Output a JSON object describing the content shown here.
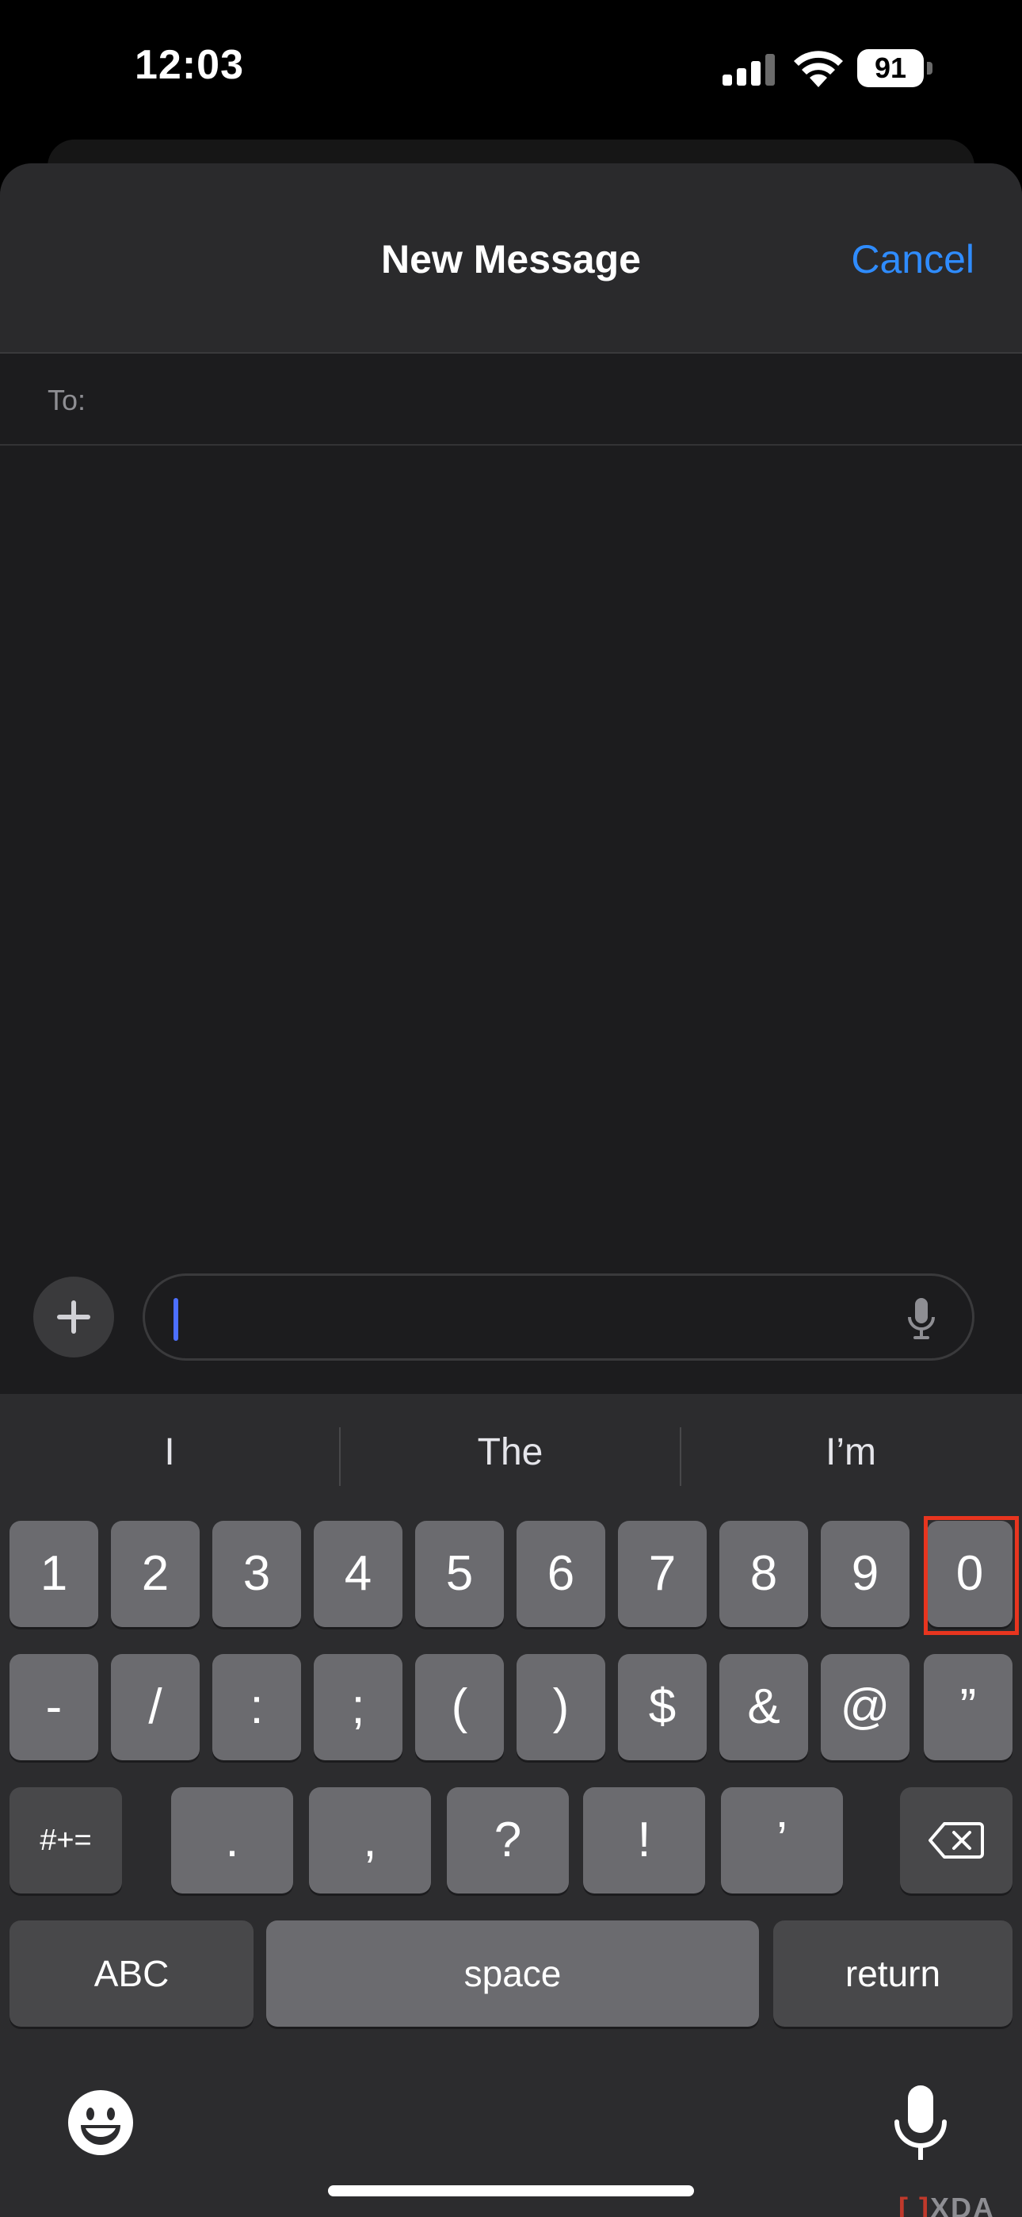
{
  "status_bar": {
    "time": "12:03",
    "battery": "91"
  },
  "header": {
    "title": "New Message",
    "cancel_label": "Cancel"
  },
  "to_field": {
    "label": "To:"
  },
  "message_input": {
    "value": ""
  },
  "predictions": [
    "I",
    "The",
    "I’m"
  ],
  "keyboard": {
    "row1": [
      "1",
      "2",
      "3",
      "4",
      "5",
      "6",
      "7",
      "8",
      "9",
      "0"
    ],
    "row2": [
      "-",
      "/",
      ":",
      ";",
      "(",
      ")",
      "$",
      "&",
      "@",
      "”"
    ],
    "row3": [
      "#+=",
      ".",
      ",",
      "?",
      "!",
      "’"
    ],
    "abc_label": "ABC",
    "space_label": "space",
    "return_label": "return"
  },
  "highlighted_key": "0",
  "watermark": {
    "bracket": "[ ]",
    "text": "XDA"
  },
  "colors": {
    "accent": "#2f8cff",
    "highlight": "#e8351f",
    "cursor": "#4c6fff"
  }
}
